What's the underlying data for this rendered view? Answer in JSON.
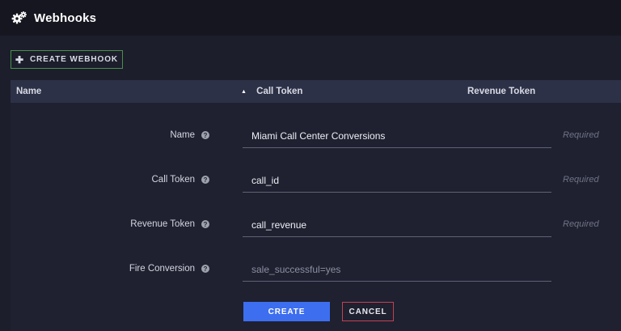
{
  "header": {
    "title": "Webhooks",
    "icon": "gears-icon"
  },
  "toolbar": {
    "create_label": "CREATE WEBHOOK",
    "create_icon": "plus-icon",
    "border_color": "#4a8f4a"
  },
  "table": {
    "columns": [
      {
        "label": "Name"
      },
      {
        "label": "Call Token",
        "sorted": "ascending"
      },
      {
        "label": "Revenue Token"
      }
    ]
  },
  "form": {
    "fields": [
      {
        "label": "Name",
        "value": "Miami Call Center Conversions",
        "placeholder": "",
        "hint": "Required"
      },
      {
        "label": "Call Token",
        "value": "call_id",
        "placeholder": "",
        "hint": "Required"
      },
      {
        "label": "Revenue Token",
        "value": "call_revenue",
        "placeholder": "",
        "hint": "Required"
      },
      {
        "label": "Fire Conversion",
        "value": "",
        "placeholder": "sale_successful=yes",
        "hint": ""
      }
    ],
    "help_glyph": "?",
    "create_label": "CREATE",
    "cancel_label": "CANCEL"
  },
  "colors": {
    "accent": "#3d6ef0",
    "danger": "#c2424f",
    "background": "#1c1e2c",
    "table_header": "#2d3147"
  }
}
